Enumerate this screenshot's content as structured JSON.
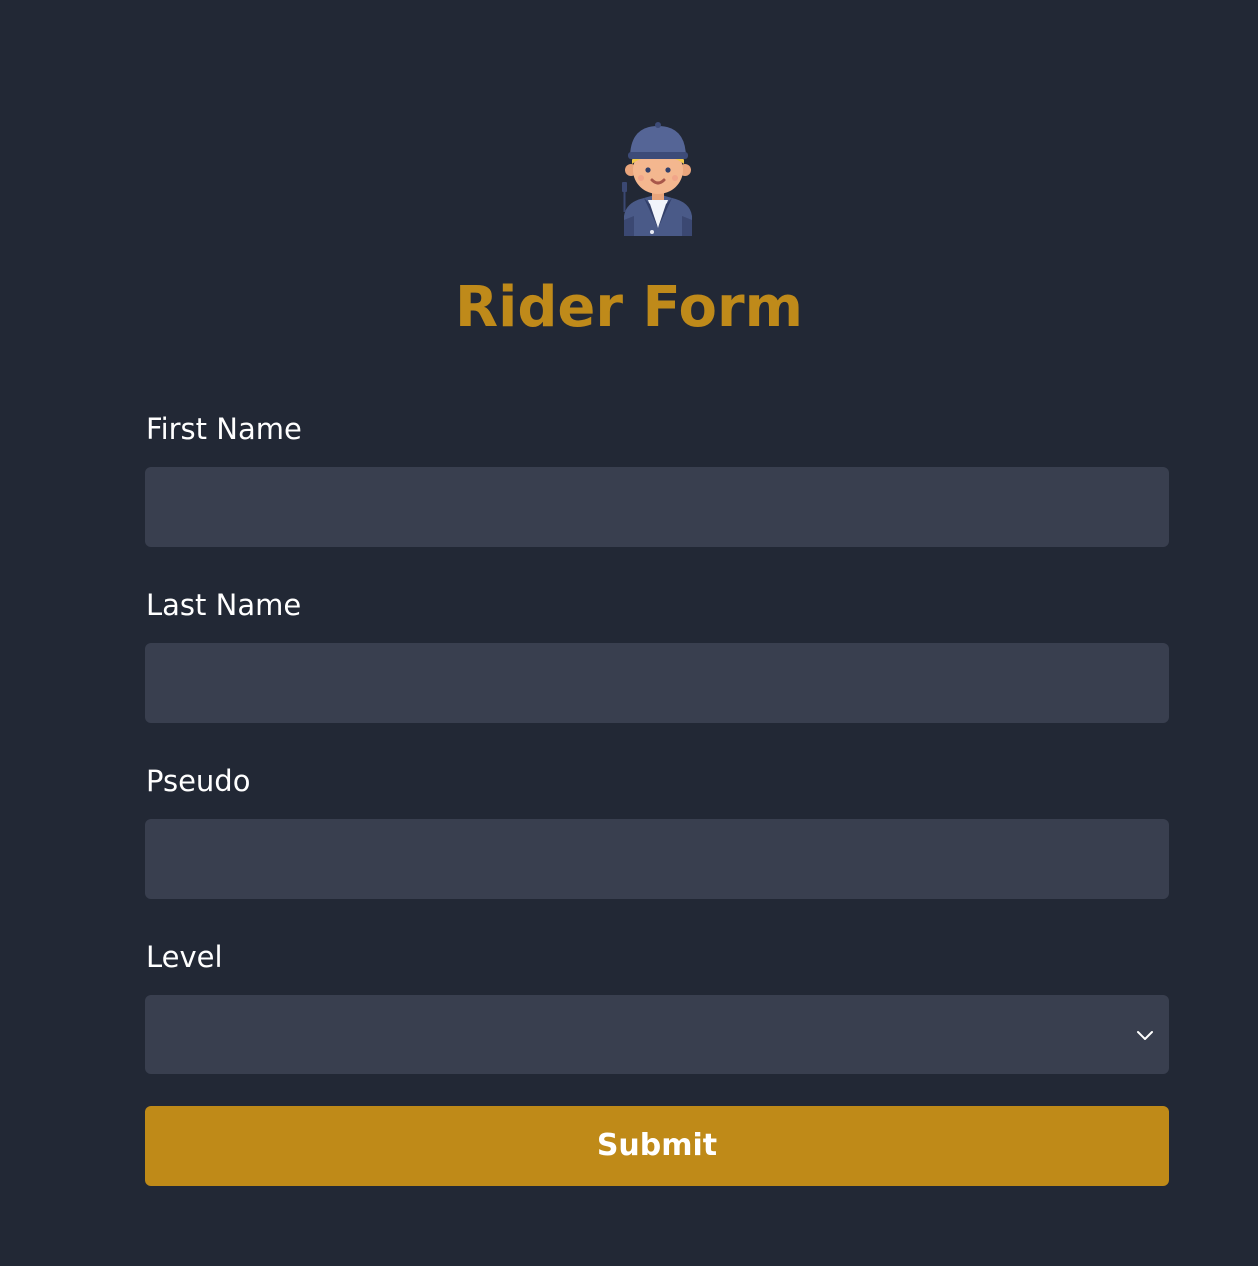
{
  "page": {
    "title": "Rider Form",
    "avatar_icon": "rider-avatar-icon"
  },
  "form": {
    "fields": [
      {
        "label": "First Name",
        "value": "",
        "placeholder": ""
      },
      {
        "label": "Last Name",
        "value": "",
        "placeholder": ""
      },
      {
        "label": "Pseudo",
        "value": "",
        "placeholder": ""
      }
    ],
    "level": {
      "label": "Level",
      "selected": "",
      "icon": "chevron-down-icon"
    },
    "submit_label": "Submit"
  },
  "colors": {
    "background": "#222835",
    "input_background": "#393f4f",
    "accent": "#bf8a18",
    "text": "#ffffff"
  }
}
